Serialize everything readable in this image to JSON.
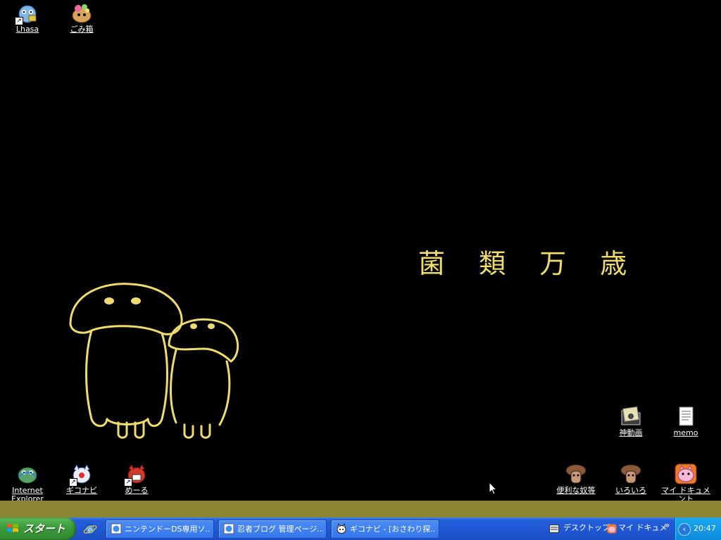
{
  "desktop": {
    "wallpaper_title": "菌 類 万 歳",
    "icons": {
      "lhasa": "Lhasa",
      "recycle": "ごみ箱",
      "ie": "Internet Explorer",
      "giconavi": "ギコナビ",
      "mail": "めーる",
      "shindouga": "神動画",
      "memo": "memo",
      "benri": "便利な奴等",
      "iroiro": "いろいろ",
      "mydocs": "マイ ドキュメント"
    }
  },
  "taskbar": {
    "start_label": "スタート",
    "tasks": [
      {
        "label": "ニンテンドーDS専用ソ..."
      },
      {
        "label": "忍者ブログ 管理ページ..."
      },
      {
        "label": "ギコナビ - [おさわり探..."
      }
    ],
    "toolbars": {
      "desktop": "デスクトップ",
      "mydocs": "マイ ドキュメ",
      "more": "»"
    },
    "clock": "20:47"
  },
  "colors": {
    "wallpaper_text": "#f0dc6e",
    "strip": "#8a8433",
    "taskbar": "#245edb",
    "start": "#3c9d3c"
  }
}
